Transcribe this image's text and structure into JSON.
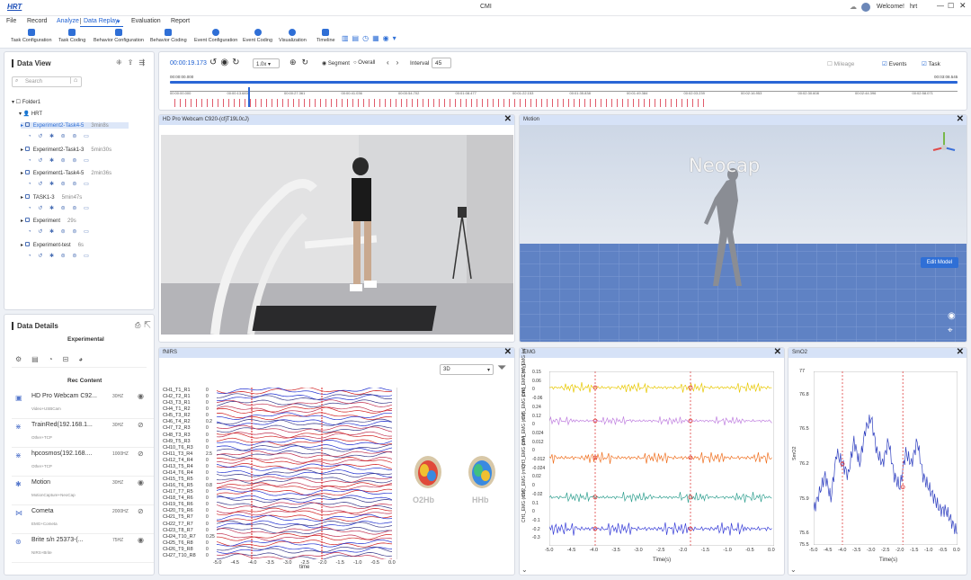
{
  "app": {
    "logo": "HRT",
    "title": "CMI",
    "welcome": "Welcome!",
    "user": "hrt"
  },
  "menu": [
    "File",
    "Record",
    "Analyze",
    "Data Replay",
    "Evaluation",
    "Report"
  ],
  "ribbon": [
    "Task Configuration",
    "Task Coding",
    "Behavior Configuration",
    "Behavior Coding",
    "Event Configuration",
    "Event Coding",
    "Visualization",
    "Timeline"
  ],
  "data_view": {
    "title": "Data View",
    "search_placeholder": "Search",
    "folder": "Folder1",
    "group": "HRT",
    "items": [
      {
        "name": "Experiment2-Task4-5",
        "dur": "3min8s"
      },
      {
        "name": "Experiment2-Task1-3",
        "dur": "5min30s"
      },
      {
        "name": "Experiment1-Task4-5",
        "dur": "2min36s"
      },
      {
        "name": "TASK1-3",
        "dur": "5min47s"
      },
      {
        "name": "Experiment",
        "dur": "29s"
      },
      {
        "name": "Experiment-test",
        "dur": "6s"
      }
    ]
  },
  "data_details": {
    "title": "Data Details",
    "tab": "Experimental",
    "rec_content": "Rec Content",
    "devices": [
      {
        "name": "HD Pro Webcam C92...",
        "sub": "Video+USBCam",
        "hz": "30HZ"
      },
      {
        "name": "TrainRed(192.168.1...",
        "sub": "Other+TCP",
        "hz": "30HZ"
      },
      {
        "name": "hpcosmos(192.168....",
        "sub": "Other+TCP",
        "hz": "1000HZ"
      },
      {
        "name": "Motion",
        "sub": "MotionCapture+NeoCap",
        "hz": "30HZ"
      },
      {
        "name": "Cometa",
        "sub": "EMG+Cometa",
        "hz": "2000HZ"
      },
      {
        "name": "Brite s/n 25373-(...",
        "sub": "NIRS+Brite",
        "hz": "75HZ"
      }
    ]
  },
  "timeline": {
    "time": "00:00:19.173",
    "speed": "1.0x",
    "segment": "Segment",
    "overall": "Overall",
    "interval_label": "Interval",
    "interval": "45",
    "mileage": "Mileage",
    "events": "Events",
    "task": "Task",
    "start": "00:00:00.000",
    "end": "00:03:08.545",
    "ticks": [
      "00:00:00.000",
      "00:00:13.683",
      "00:00:27.361",
      "00:00:41.036",
      "00:00:54.702",
      "00:01:08.477",
      "00:01:22.153",
      "00:01:35.838",
      "00:01:49.384",
      "00:02:03.239",
      "00:02:16.953",
      "00:02:30.608",
      "00:02:44.396",
      "00:02:58.071"
    ]
  },
  "webcam": {
    "title": "HD Pro Webcam C920-(cfjT19L0cJ)"
  },
  "motion": {
    "title": "Motion",
    "brand": "Neocap",
    "edit": "Edit Model"
  },
  "fnirs": {
    "title": "fNIRS",
    "mode": "3D",
    "o2hb": "O2Hb",
    "hhb": "HHb",
    "xlabel": "time",
    "channels": [
      "CH1_T1_R1",
      "CH2_T2_R1",
      "CH3_T3_R1",
      "CH4_T1_R2",
      "CH5_T3_R2",
      "CH6_T4_R2",
      "CH7_T2_R3",
      "CH8_T3_R3",
      "CH9_T5_R3",
      "CH10_T6_R3",
      "CH11_T3_R4",
      "CH12_T4_R4",
      "CH13_T5_R4",
      "CH14_T6_R4",
      "CH15_T5_R5",
      "CH16_T6_R5",
      "CH17_T7_R5",
      "CH18_T4_R6",
      "CH19_T6_R6",
      "CH20_T9_R6",
      "CH21_T5_R7",
      "CH22_T7_R7",
      "CH23_T8_R7",
      "CH24_T10_R7",
      "CH25_T6_R8",
      "CH26_T9_R8",
      "CH27_T10_R8"
    ],
    "yticks": [
      "0",
      "0",
      "0",
      "0",
      "0",
      "0.2",
      "0",
      "0",
      "0",
      "0",
      "2.5",
      "0",
      "0",
      "0",
      "0",
      "0.8",
      "0",
      "0",
      "0",
      "0",
      "0",
      "0",
      "0",
      "0.25",
      "0",
      "0",
      "0"
    ],
    "xticks": [
      "-5.0",
      "-4.5",
      "-4.0",
      "-3.5",
      "-3.0",
      "-2.5",
      "-2.0",
      "-1.5",
      "-1.0",
      "-0.5",
      "0.0"
    ]
  },
  "emg": {
    "title": "EMG",
    "xlabel": "Time(s)",
    "ylabels": [
      "CH1_EMG (mV)",
      "CH2_EMG (mV)",
      "CH3_EMG (mV)",
      "CH4_EMG (mV)",
      "CH5_EMG (mV)",
      "CH6_EMG (mV)",
      "CH7_EMG (mV)"
    ],
    "yticks": [
      "0.15",
      "0.06",
      "0",
      "-0.06",
      "0.24",
      "0.12",
      "0",
      "0.024",
      "0.012",
      "0",
      "-0.012",
      "-0.024",
      "0.02",
      "0",
      "-0.02",
      "0.1",
      "0",
      "-0.1",
      "-0.2",
      "-0.3"
    ],
    "xticks": [
      "-5.0",
      "-4.5",
      "-4.0",
      "-3.5",
      "-3.0",
      "-2.5",
      "-2.0",
      "-1.5",
      "-1.0",
      "-0.5",
      "0.0"
    ]
  },
  "smo2": {
    "title": "SmO2",
    "ylabel": "SmO2",
    "xlabel": "Time(s)",
    "yticks": [
      "77",
      "76.8",
      "76.5",
      "76.2",
      "75.9",
      "75.6",
      "75.5"
    ],
    "xticks": [
      "-5.0",
      "-4.5",
      "-4.0",
      "-3.5",
      "-3.0",
      "-2.5",
      "-2.0",
      "-1.5",
      "-1.0",
      "-0.5",
      "0.0"
    ]
  },
  "chart_data": [
    {
      "type": "line",
      "title": "SmO2",
      "ylabel": "SmO2",
      "xlabel": "Time(s)",
      "xlim": [
        -5,
        0
      ],
      "ylim": [
        75.5,
        77
      ],
      "x": [
        -5.0,
        -4.8,
        -4.6,
        -4.4,
        -4.2,
        -4.0,
        -3.8,
        -3.6,
        -3.4,
        -3.2,
        -3.0,
        -2.8,
        -2.6,
        -2.4,
        -2.2,
        -2.0,
        -1.8,
        -1.6,
        -1.4,
        -1.2,
        -1.0,
        -0.8,
        -0.6,
        -0.4,
        -0.2,
        0.0
      ],
      "series": [
        {
          "values": [
            75.8,
            75.95,
            76.1,
            75.9,
            76.3,
            76.2,
            76.1,
            76.4,
            76.2,
            76.5,
            76.6,
            76.3,
            76.2,
            76.4,
            76.1,
            76.0,
            76.3,
            76.2,
            76.4,
            76.1,
            76.0,
            75.9,
            75.8,
            75.8,
            75.7,
            75.6
          ]
        }
      ]
    }
  ]
}
